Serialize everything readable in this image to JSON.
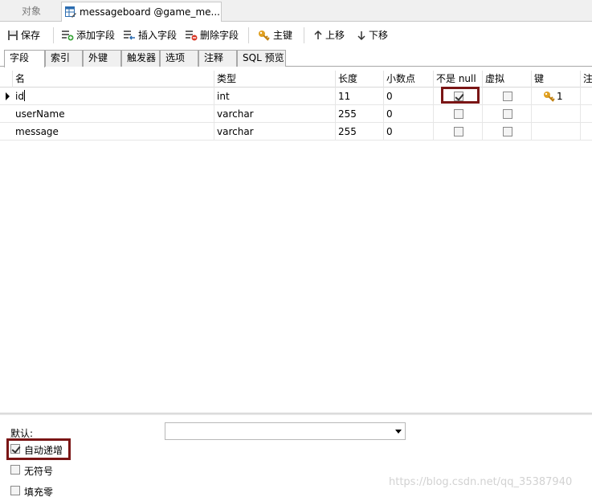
{
  "window_tabs": [
    {
      "label": "对象",
      "active": false
    },
    {
      "label": "messageboard @game_me...",
      "active": true
    }
  ],
  "toolbar": {
    "save": "保存",
    "add_field": "添加字段",
    "insert_field": "插入字段",
    "delete_field": "删除字段",
    "primary_key": "主键",
    "move_up": "上移",
    "move_down": "下移"
  },
  "sub_tabs": [
    "字段",
    "索引",
    "外键",
    "触发器",
    "选项",
    "注释",
    "SQL 预览"
  ],
  "columns": {
    "name": "名",
    "type": "类型",
    "length": "长度",
    "decimals": "小数点",
    "not_null": "不是 null",
    "virtual": "虚拟",
    "key": "键",
    "comment": "注"
  },
  "rows": [
    {
      "name": "id",
      "type": "int",
      "length": "11",
      "decimals": "0",
      "not_null": true,
      "virtual": false,
      "key": "1",
      "selected": true
    },
    {
      "name": "userName",
      "type": "varchar",
      "length": "255",
      "decimals": "0",
      "not_null": false,
      "virtual": false,
      "key": "",
      "selected": false
    },
    {
      "name": "message",
      "type": "varchar",
      "length": "255",
      "decimals": "0",
      "not_null": false,
      "virtual": false,
      "key": "",
      "selected": false
    }
  ],
  "options": {
    "default_label": "默认:",
    "default_value": "",
    "auto_increment": {
      "label": "自动递增",
      "checked": true
    },
    "unsigned": {
      "label": "无符号",
      "checked": false
    },
    "zerofill": {
      "label": "填充零",
      "checked": false
    }
  },
  "watermark": "https://blog.csdn.net/qq_35387940",
  "colors": {
    "highlight": "#7a1515",
    "key_icon": "#e0a020"
  }
}
